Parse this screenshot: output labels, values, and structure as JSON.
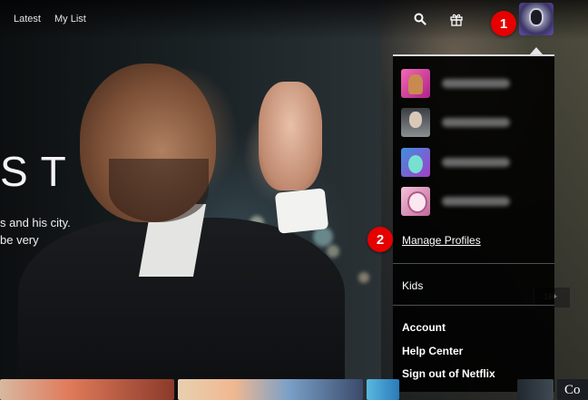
{
  "nav": {
    "links": [
      "Latest",
      "My List"
    ],
    "search_icon": "search-icon",
    "gift_icon": "gift-icon",
    "avatar_icon": "robot-avatar-icon"
  },
  "hero": {
    "title_fragment": "ST",
    "description_lines": [
      "s and his city.",
      "be very"
    ]
  },
  "menu": {
    "profiles": [
      {
        "avatar": "profile-avatar-pink-horse"
      },
      {
        "avatar": "profile-avatar-man"
      },
      {
        "avatar": "profile-avatar-blue-creature"
      },
      {
        "avatar": "profile-avatar-pink-character"
      }
    ],
    "manage_profiles": "Manage Profiles",
    "kids": "Kids",
    "account": "Account",
    "help_center": "Help Center",
    "sign_out": "Sign out of Netflix"
  },
  "badges": {
    "one": "1",
    "two": "2"
  },
  "side_marker": "16+",
  "bottom_row": {
    "last_thumb_text": "Co"
  },
  "colors": {
    "badge": "#e60000",
    "menu_bg": "#000000",
    "menu_text": "#ffffff"
  }
}
